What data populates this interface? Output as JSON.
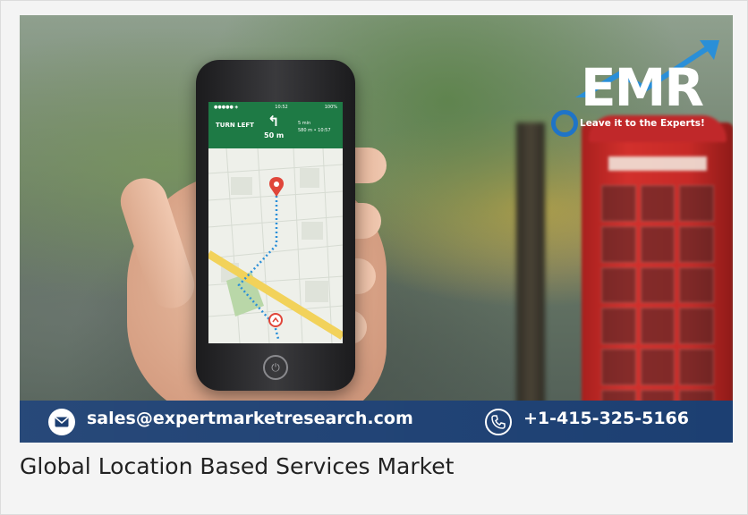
{
  "banner": {
    "logo_text": "EMR",
    "logo_tagline": "Leave it to the Experts!",
    "email": "sales@expertmarketresearch.com",
    "phone": "+1-415-325-5166"
  },
  "phone_screen": {
    "status_time": "10:52",
    "status_battery": "100%",
    "instruction": "TURN LEFT",
    "turn_arrow": "↰",
    "distance": "50 m",
    "eta_line1": "5 min",
    "eta_line2": "580 m • 10:57"
  },
  "caption": "Global Location Based Services Market",
  "colors": {
    "contact_bar": "#1c3f72",
    "nav_green": "#1e7a45",
    "route_dots": "#2a8fd8",
    "pin_red": "#e0463a",
    "logo_ring": "#1f74c7"
  },
  "icons": [
    "email-icon",
    "phone-icon",
    "power-icon",
    "map-pin-icon",
    "turn-left-icon",
    "trend-arrow-icon"
  ]
}
